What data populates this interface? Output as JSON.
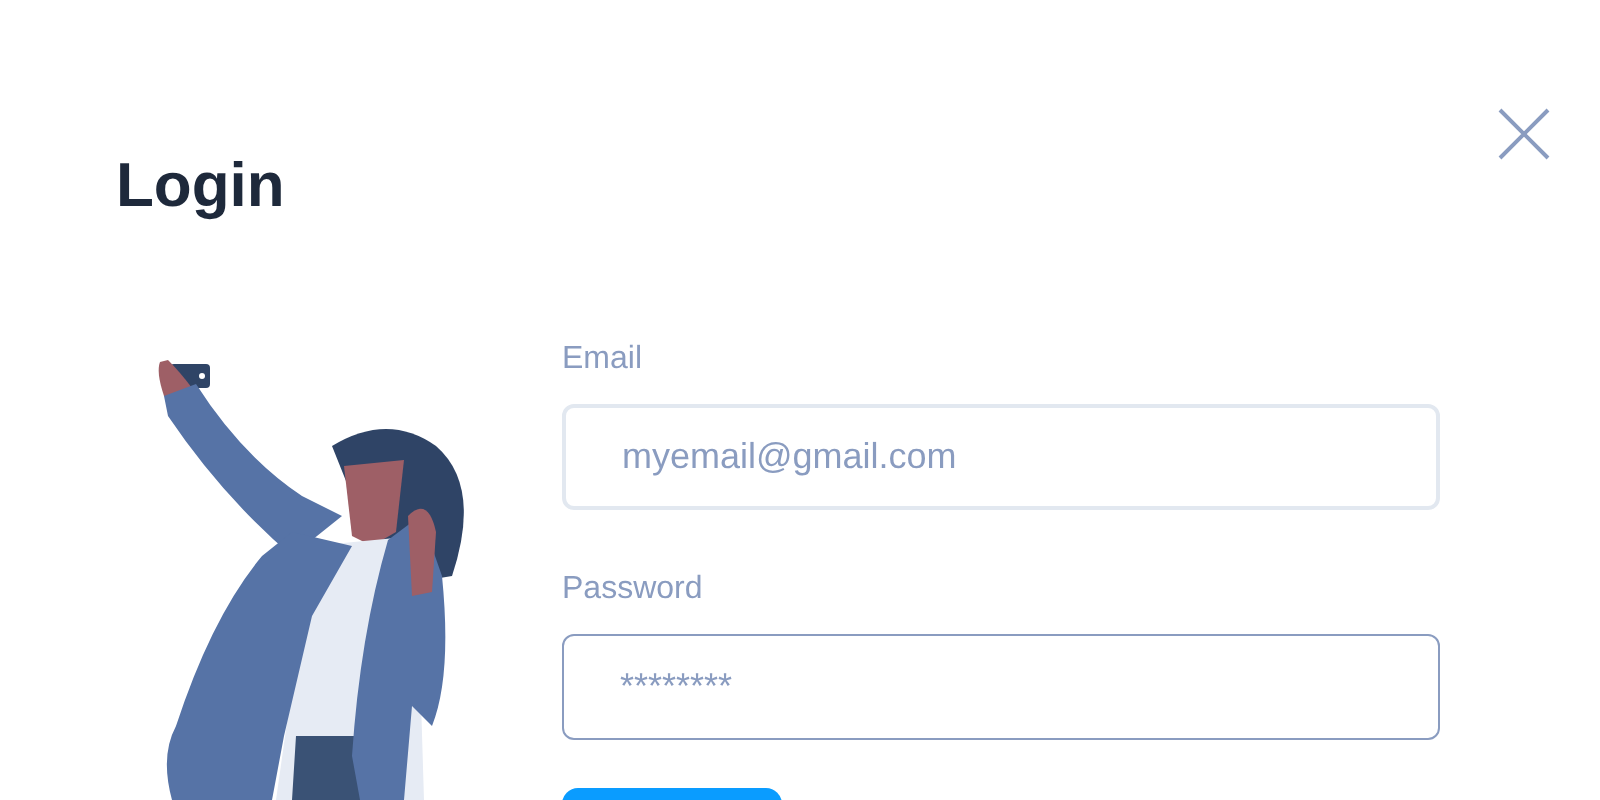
{
  "dialog": {
    "title": "Login"
  },
  "fields": [
    {
      "label": "Email",
      "placeholder": "myemail@gmail.com",
      "focused": false
    },
    {
      "label": "Password",
      "placeholder": "********",
      "focused": true
    }
  ],
  "submit": {
    "kind": "button"
  }
}
